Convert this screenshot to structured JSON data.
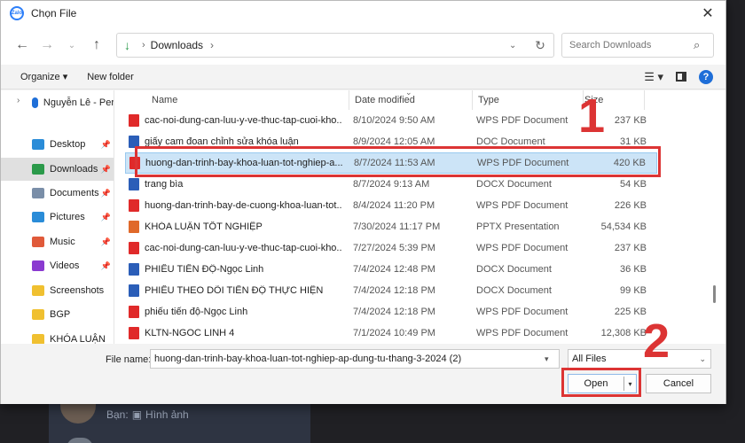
{
  "window": {
    "title": "Chọn File"
  },
  "nav": {
    "path": [
      "Downloads"
    ],
    "search_placeholder": "Search Downloads"
  },
  "commands": {
    "organize": "Organize ▾",
    "new_folder": "New folder"
  },
  "sidebar": {
    "account": "Nguyễn Lê - Per",
    "items": [
      {
        "label": "Desktop",
        "icon": "desktop-icon",
        "color": "#2a8cd8",
        "pinned": true
      },
      {
        "label": "Downloads",
        "icon": "download-icon",
        "color": "#2b9a4a",
        "pinned": true,
        "selected": true
      },
      {
        "label": "Documents",
        "icon": "documents-icon",
        "color": "#7a8ea8",
        "pinned": true
      },
      {
        "label": "Pictures",
        "icon": "pictures-icon",
        "color": "#2a8cd8",
        "pinned": true
      },
      {
        "label": "Music",
        "icon": "music-icon",
        "color": "#e05a3a",
        "pinned": true
      },
      {
        "label": "Videos",
        "icon": "videos-icon",
        "color": "#8a3ad0",
        "pinned": true
      },
      {
        "label": "Screenshots",
        "icon": "folder-icon",
        "color": "#f0c030",
        "pinned": false
      },
      {
        "label": "BGP",
        "icon": "folder-icon",
        "color": "#f0c030",
        "pinned": false
      },
      {
        "label": "KHÓA LUẬN",
        "icon": "folder-icon",
        "color": "#f0c030",
        "pinned": false
      }
    ]
  },
  "columns": {
    "name": "Name",
    "date": "Date modified",
    "type": "Type",
    "size": "Size"
  },
  "files": [
    {
      "name": "cac-noi-dung-can-luu-y-ve-thuc-tap-cuoi-kho...",
      "date": "8/10/2024 9:50 AM",
      "type": "WPS PDF Document",
      "size": "237 KB",
      "kind": "pdf"
    },
    {
      "name": "giấy cam đoan chỉnh sửa khóa luận",
      "date": "8/9/2024 12:05 AM",
      "type": "DOC Document",
      "size": "31 KB",
      "kind": "doc"
    },
    {
      "name": "huong-dan-trinh-bay-khoa-luan-tot-nghiep-a...",
      "date": "8/7/2024 11:53 AM",
      "type": "WPS PDF Document",
      "size": "420 KB",
      "kind": "pdf",
      "selected": true
    },
    {
      "name": "trang bìa",
      "date": "8/7/2024 9:13 AM",
      "type": "DOCX Document",
      "size": "54 KB",
      "kind": "doc"
    },
    {
      "name": "huong-dan-trinh-bay-de-cuong-khoa-luan-tot...",
      "date": "8/4/2024 11:20 PM",
      "type": "WPS PDF Document",
      "size": "226 KB",
      "kind": "pdf"
    },
    {
      "name": "KHÓA LUẬN TỐT NGHIỆP",
      "date": "7/30/2024 11:17 PM",
      "type": "PPTX Presentation",
      "size": "54,534 KB",
      "kind": "ppt"
    },
    {
      "name": "cac-noi-dung-can-luu-y-ve-thuc-tap-cuoi-kho...",
      "date": "7/27/2024 5:39 PM",
      "type": "WPS PDF Document",
      "size": "237 KB",
      "kind": "pdf"
    },
    {
      "name": "PHIẾU TIẾN ĐỘ-Ngọc Linh",
      "date": "7/4/2024 12:48 PM",
      "type": "DOCX Document",
      "size": "36 KB",
      "kind": "doc"
    },
    {
      "name": "PHIẾU THEO DÕI TIẾN ĐỘ THỰC HIỆN",
      "date": "7/4/2024 12:18 PM",
      "type": "DOCX Document",
      "size": "99 KB",
      "kind": "doc"
    },
    {
      "name": "phiếu tiến độ-Ngọc Linh",
      "date": "7/4/2024 12:18 PM",
      "type": "WPS PDF Document",
      "size": "225 KB",
      "kind": "pdf"
    },
    {
      "name": "KLTN-NGOC LINH 4",
      "date": "7/1/2024 10:49 PM",
      "type": "WPS PDF Document",
      "size": "12,308 KB",
      "kind": "pdf"
    }
  ],
  "footer": {
    "filename_label": "File name:",
    "filename_value": "huong-dan-trinh-bay-khoa-luan-tot-nghiep-ap-dung-tu-thang-3-2024 (2)",
    "filter": "All Files",
    "open": "Open",
    "cancel": "Cancel"
  },
  "annotations": {
    "step1": "1",
    "step2": "2",
    "color": "#dc3434"
  },
  "background_chat": {
    "preview_prefix": "Bạn:",
    "preview_text": "Hình ảnh"
  }
}
